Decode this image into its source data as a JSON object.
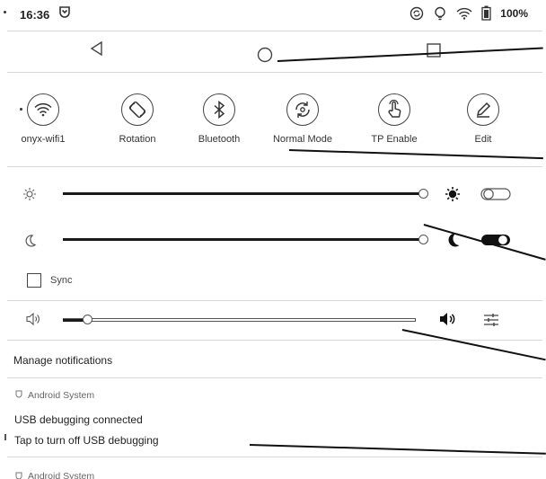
{
  "status_bar": {
    "time": "16:36",
    "battery": "100%"
  },
  "nav_bar": {
    "back_icon": "triangle-back-icon",
    "home_icon": "circle-home-icon",
    "recents_icon": "square-recents-icon"
  },
  "quick_settings": [
    {
      "label": "onyx-wifi1",
      "icon": "wifi-icon"
    },
    {
      "label": "Rotation",
      "icon": "rotation-icon"
    },
    {
      "label": "Bluetooth",
      "icon": "bluetooth-icon"
    },
    {
      "label": "Normal Mode",
      "icon": "refresh-mode-icon"
    },
    {
      "label": "TP Enable",
      "icon": "touch-icon"
    },
    {
      "label": "Edit",
      "icon": "pencil-icon"
    }
  ],
  "sliders": {
    "brightness": {
      "level": 1.0,
      "icon": "sun-icon"
    },
    "warm_light": {
      "level": 1.0,
      "icon": "moon-icon"
    },
    "volume": {
      "level": 0.07,
      "icon": "speaker-icon"
    }
  },
  "sync": {
    "label": "Sync",
    "checked": false
  },
  "manage_notifications": "Manage notifications",
  "notifications": [
    {
      "app": "Android System",
      "title": "USB debugging connected",
      "text": "Tap to turn off USB debugging"
    },
    {
      "app": "Android System"
    }
  ]
}
